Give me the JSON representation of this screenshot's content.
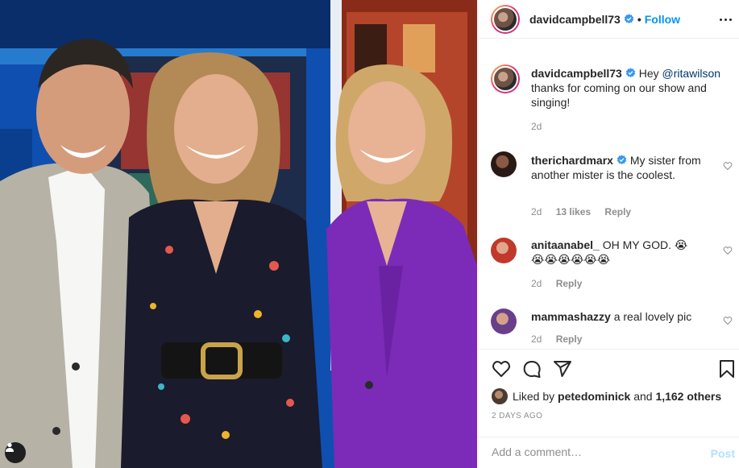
{
  "post": {
    "author": "davidcampbell73",
    "follow_label": "Follow",
    "separator": "•",
    "caption_text": "Hey",
    "caption_mention": "@ritawilson",
    "caption_rest": "thanks for coming on our show and singing!",
    "caption_age": "2d"
  },
  "comments": [
    {
      "user": "therichardmarx",
      "verified": true,
      "text": "My sister from another mister is the coolest.",
      "age": "2d",
      "likes": "13 likes",
      "reply": "Reply"
    },
    {
      "user": "anitaanabel_",
      "verified": false,
      "text": "OH MY GOD. 😭",
      "text2": "😭😭😭😭😭😭",
      "age": "2d",
      "reply": "Reply"
    },
    {
      "user": "mammashazzy",
      "verified": false,
      "text": "a real lovely pic",
      "age": "2d",
      "reply": "Reply"
    }
  ],
  "likes": {
    "prefix": "Liked by",
    "user": "petedominick",
    "and": "and",
    "count": "1,162 others"
  },
  "timestamp": "2 DAYS AGO",
  "comment_box": {
    "placeholder": "Add a comment…",
    "post_label": "Post"
  },
  "icons": {
    "verified": "verified-badge-icon",
    "like": "heart-icon",
    "comment": "comment-icon",
    "share": "share-icon",
    "save": "bookmark-icon",
    "more": "more-icon",
    "tags": "user-tag-icon"
  },
  "colors": {
    "link": "#0095f6",
    "mention": "#00376b",
    "muted": "#8e8e8e",
    "post_disabled": "#b2dffc"
  }
}
